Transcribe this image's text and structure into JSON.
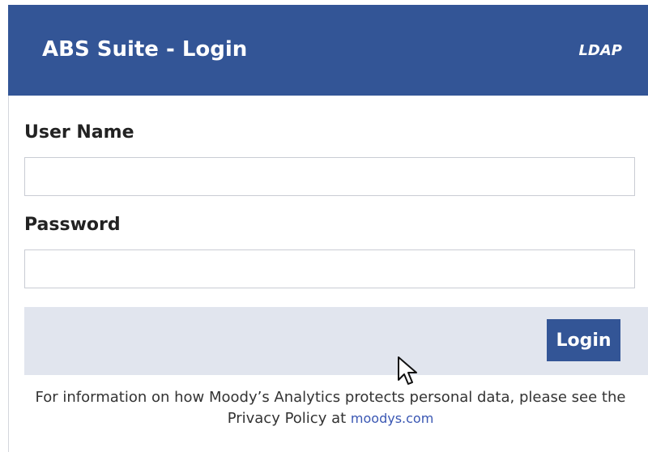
{
  "header": {
    "title": "ABS Suite - Login",
    "auth_mode": "LDAP"
  },
  "form": {
    "username_label": "User Name",
    "username_value": "",
    "password_label": "Password",
    "password_value": "",
    "login_label": "Login"
  },
  "footer": {
    "text": "For information on how Moody’s Analytics protects personal data, please see the Privacy Policy at",
    "link_text": "moodys.com"
  },
  "colors": {
    "header_bg": "#335596",
    "button_bg": "#335596",
    "button_bar_bg": "#e1e5ee",
    "link": "#3a57b3"
  },
  "icons": {
    "cursor": "mouse-pointer-icon"
  }
}
